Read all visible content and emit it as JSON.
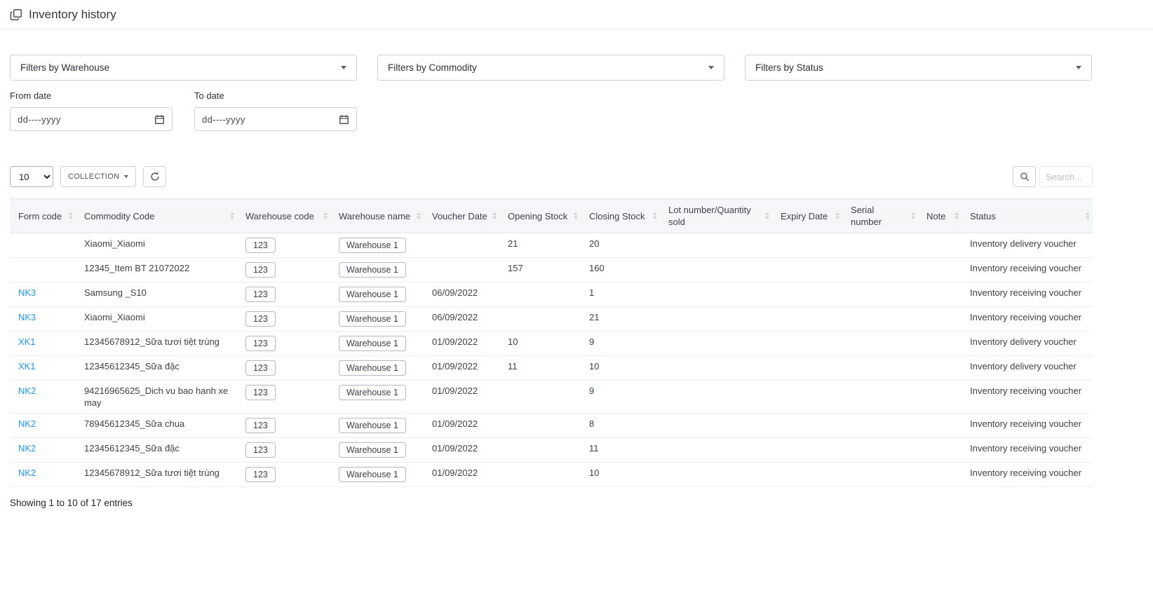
{
  "page": {
    "title": "Inventory history"
  },
  "colors": {
    "accent_blue": "#2196f3",
    "header_bg": "#f5f6f8"
  },
  "icons": {
    "title": "copy-icon",
    "dropdown": "chevron-down-icon",
    "date": "calendar-icon",
    "refresh": "refresh-icon",
    "search": "magnifier-icon",
    "sort": "sort-arrows-icon"
  },
  "filters": {
    "warehouse_placeholder": "Filters by Warehouse",
    "commodity_placeholder": "Filters by Commodity",
    "status_placeholder": "Filters by Status",
    "from_date_label": "From date",
    "to_date_label": "To date",
    "date_placeholder": "dd----yyyy"
  },
  "toolbar": {
    "page_size": "10",
    "collection_label": "COLLECTION",
    "search_placeholder": "Search..."
  },
  "table": {
    "headers": [
      "Form code",
      "Commodity Code",
      "Warehouse code",
      "Warehouse name",
      "Voucher Date",
      "Opening Stock",
      "Closing Stock",
      "Lot number/Quantity sold",
      "Expiry Date",
      "Serial number",
      "Note",
      "Status"
    ],
    "rows": [
      {
        "form_code": "",
        "commodity": "Xiaomi_Xiaomi",
        "warehouse_code": "123",
        "warehouse_name": "Warehouse 1",
        "voucher_date": "",
        "opening_stock": "21",
        "closing_stock": "20",
        "lot_number": "",
        "expiry_date": "",
        "serial_number": "",
        "note": "",
        "status": "Inventory delivery voucher"
      },
      {
        "form_code": "",
        "commodity": "12345_Item BT 21072022",
        "warehouse_code": "123",
        "warehouse_name": "Warehouse 1",
        "voucher_date": "",
        "opening_stock": "157",
        "closing_stock": "160",
        "lot_number": "",
        "expiry_date": "",
        "serial_number": "",
        "note": "",
        "status": "Inventory receiving voucher"
      },
      {
        "form_code": "NK3",
        "commodity": "Samsung _S10",
        "warehouse_code": "123",
        "warehouse_name": "Warehouse 1",
        "voucher_date": "06/09/2022",
        "opening_stock": "",
        "closing_stock": "1",
        "lot_number": "",
        "expiry_date": "",
        "serial_number": "",
        "note": "",
        "status": "Inventory receiving voucher"
      },
      {
        "form_code": "NK3",
        "commodity": "Xiaomi_Xiaomi",
        "warehouse_code": "123",
        "warehouse_name": "Warehouse 1",
        "voucher_date": "06/09/2022",
        "opening_stock": "",
        "closing_stock": "21",
        "lot_number": "",
        "expiry_date": "",
        "serial_number": "",
        "note": "",
        "status": "Inventory receiving voucher"
      },
      {
        "form_code": "XK1",
        "commodity": "12345678912_Sữa tươi tiệt trùng",
        "warehouse_code": "123",
        "warehouse_name": "Warehouse 1",
        "voucher_date": "01/09/2022",
        "opening_stock": "10",
        "closing_stock": "9",
        "lot_number": "",
        "expiry_date": "",
        "serial_number": "",
        "note": "",
        "status": "Inventory delivery voucher"
      },
      {
        "form_code": "XK1",
        "commodity": "12345612345_Sữa đặc",
        "warehouse_code": "123",
        "warehouse_name": "Warehouse 1",
        "voucher_date": "01/09/2022",
        "opening_stock": "11",
        "closing_stock": "10",
        "lot_number": "",
        "expiry_date": "",
        "serial_number": "",
        "note": "",
        "status": "Inventory delivery voucher"
      },
      {
        "form_code": "NK2",
        "commodity": "94216965625_Dich vu bao hanh xe may",
        "warehouse_code": "123",
        "warehouse_name": "Warehouse 1",
        "voucher_date": "01/09/2022",
        "opening_stock": "",
        "closing_stock": "9",
        "lot_number": "",
        "expiry_date": "",
        "serial_number": "",
        "note": "",
        "status": "Inventory receiving voucher"
      },
      {
        "form_code": "NK2",
        "commodity": "78945612345_Sữa chua",
        "warehouse_code": "123",
        "warehouse_name": "Warehouse 1",
        "voucher_date": "01/09/2022",
        "opening_stock": "",
        "closing_stock": "8",
        "lot_number": "",
        "expiry_date": "",
        "serial_number": "",
        "note": "",
        "status": "Inventory receiving voucher"
      },
      {
        "form_code": "NK2",
        "commodity": "12345612345_Sữa đặc",
        "warehouse_code": "123",
        "warehouse_name": "Warehouse 1",
        "voucher_date": "01/09/2022",
        "opening_stock": "",
        "closing_stock": "11",
        "lot_number": "",
        "expiry_date": "",
        "serial_number": "",
        "note": "",
        "status": "Inventory receiving voucher"
      },
      {
        "form_code": "NK2",
        "commodity": "12345678912_Sữa tươi tiệt trùng",
        "warehouse_code": "123",
        "warehouse_name": "Warehouse 1",
        "voucher_date": "01/09/2022",
        "opening_stock": "",
        "closing_stock": "10",
        "lot_number": "",
        "expiry_date": "",
        "serial_number": "",
        "note": "",
        "status": "Inventory receiving voucher"
      }
    ],
    "info_text": "Showing 1 to 10 of 17 entries"
  }
}
